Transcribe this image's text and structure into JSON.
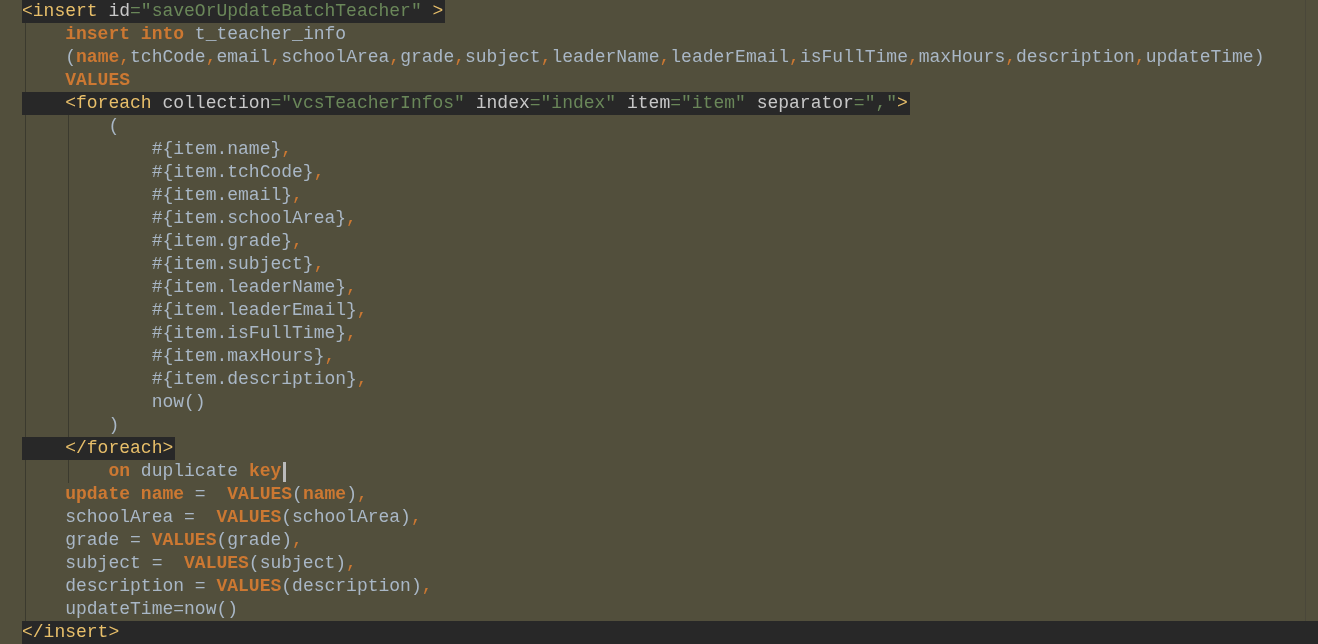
{
  "editor": {
    "lines": [
      {
        "kind": "tag",
        "tokens": [
          {
            "kind": "tag",
            "text": "<insert "
          },
          {
            "kind": "attr",
            "text": "id"
          },
          {
            "kind": "str",
            "text": "=\"saveOrUpdateBatchTeacher\""
          },
          {
            "kind": "tag",
            "text": " >"
          }
        ]
      },
      {
        "kind": "plain",
        "tokens": [
          {
            "kind": "kw",
            "text": "    insert into"
          },
          {
            "kind": "text",
            "text": " t_teacher_info"
          }
        ]
      },
      {
        "kind": "plain",
        "tokens": [
          {
            "kind": "text",
            "text": "    ("
          },
          {
            "kind": "kw",
            "text": "name"
          },
          {
            "kind": "comma",
            "text": ","
          },
          {
            "kind": "text",
            "text": "tchCode"
          },
          {
            "kind": "comma",
            "text": ","
          },
          {
            "kind": "text",
            "text": "email"
          },
          {
            "kind": "comma",
            "text": ","
          },
          {
            "kind": "text",
            "text": "schoolArea"
          },
          {
            "kind": "comma",
            "text": ","
          },
          {
            "kind": "text",
            "text": "grade"
          },
          {
            "kind": "comma",
            "text": ","
          },
          {
            "kind": "text",
            "text": "subject"
          },
          {
            "kind": "comma",
            "text": ","
          },
          {
            "kind": "text",
            "text": "leaderName"
          },
          {
            "kind": "comma",
            "text": ","
          },
          {
            "kind": "text",
            "text": "leaderEmail"
          },
          {
            "kind": "comma",
            "text": ","
          },
          {
            "kind": "text",
            "text": "isFullTime"
          },
          {
            "kind": "comma",
            "text": ","
          },
          {
            "kind": "text",
            "text": "maxHours"
          },
          {
            "kind": "comma",
            "text": ","
          },
          {
            "kind": "text",
            "text": "description"
          },
          {
            "kind": "comma",
            "text": ","
          },
          {
            "kind": "text",
            "text": "updateTime)"
          }
        ]
      },
      {
        "kind": "plain",
        "tokens": [
          {
            "kind": "kw",
            "text": "    VALUES"
          }
        ]
      },
      {
        "kind": "tag",
        "tokens": [
          {
            "kind": "tag",
            "text": "    <foreach "
          },
          {
            "kind": "attr",
            "text": "collection"
          },
          {
            "kind": "str",
            "text": "=\"vcsTeacherInfos\""
          },
          {
            "kind": "attr",
            "text": " index"
          },
          {
            "kind": "str",
            "text": "=\"index\""
          },
          {
            "kind": "attr",
            "text": " item"
          },
          {
            "kind": "str",
            "text": "=\"item\""
          },
          {
            "kind": "attr",
            "text": " separator"
          },
          {
            "kind": "str",
            "text": "=\",\""
          },
          {
            "kind": "tag",
            "text": ">"
          }
        ]
      },
      {
        "kind": "plain",
        "tokens": [
          {
            "kind": "text",
            "text": "        ("
          }
        ]
      },
      {
        "kind": "plain",
        "tokens": [
          {
            "kind": "text",
            "text": "            #{item.name}"
          },
          {
            "kind": "comma",
            "text": ","
          }
        ]
      },
      {
        "kind": "plain",
        "tokens": [
          {
            "kind": "text",
            "text": "            #{item.tchCode}"
          },
          {
            "kind": "comma",
            "text": ","
          }
        ]
      },
      {
        "kind": "plain",
        "tokens": [
          {
            "kind": "text",
            "text": "            #{item.email}"
          },
          {
            "kind": "comma",
            "text": ","
          }
        ]
      },
      {
        "kind": "plain",
        "tokens": [
          {
            "kind": "text",
            "text": "            #{item.schoolArea}"
          },
          {
            "kind": "comma",
            "text": ","
          }
        ]
      },
      {
        "kind": "plain",
        "tokens": [
          {
            "kind": "text",
            "text": "            #{item.grade}"
          },
          {
            "kind": "comma",
            "text": ","
          }
        ]
      },
      {
        "kind": "plain",
        "tokens": [
          {
            "kind": "text",
            "text": "            #{item.subject}"
          },
          {
            "kind": "comma",
            "text": ","
          }
        ]
      },
      {
        "kind": "plain",
        "tokens": [
          {
            "kind": "text",
            "text": "            #{item.leaderName}"
          },
          {
            "kind": "comma",
            "text": ","
          }
        ]
      },
      {
        "kind": "plain",
        "tokens": [
          {
            "kind": "text",
            "text": "            #{item.leaderEmail}"
          },
          {
            "kind": "comma",
            "text": ","
          }
        ]
      },
      {
        "kind": "plain",
        "tokens": [
          {
            "kind": "text",
            "text": "            #{item.isFullTime}"
          },
          {
            "kind": "comma",
            "text": ","
          }
        ]
      },
      {
        "kind": "plain",
        "tokens": [
          {
            "kind": "text",
            "text": "            #{item.maxHours}"
          },
          {
            "kind": "comma",
            "text": ","
          }
        ]
      },
      {
        "kind": "plain",
        "tokens": [
          {
            "kind": "text",
            "text": "            #{item.description}"
          },
          {
            "kind": "comma",
            "text": ","
          }
        ]
      },
      {
        "kind": "plain",
        "tokens": [
          {
            "kind": "text",
            "text": "            now()"
          }
        ]
      },
      {
        "kind": "plain",
        "tokens": [
          {
            "kind": "text",
            "text": "        )"
          }
        ]
      },
      {
        "kind": "tag",
        "tokens": [
          {
            "kind": "tag",
            "text": "    </foreach>"
          }
        ]
      },
      {
        "kind": "plain",
        "cursor": true,
        "tokens": [
          {
            "kind": "kw",
            "text": "        on"
          },
          {
            "kind": "text",
            "text": " duplicate "
          },
          {
            "kind": "kw",
            "text": "key"
          }
        ]
      },
      {
        "kind": "plain",
        "tokens": [
          {
            "kind": "kw",
            "text": "    update name"
          },
          {
            "kind": "text",
            "text": " =  "
          },
          {
            "kind": "kw",
            "text": "VALUES"
          },
          {
            "kind": "text",
            "text": "("
          },
          {
            "kind": "kw",
            "text": "name"
          },
          {
            "kind": "text",
            "text": ")"
          },
          {
            "kind": "comma",
            "text": ","
          }
        ]
      },
      {
        "kind": "plain",
        "tokens": [
          {
            "kind": "text",
            "text": "    schoolArea =  "
          },
          {
            "kind": "kw",
            "text": "VALUES"
          },
          {
            "kind": "text",
            "text": "(schoolArea)"
          },
          {
            "kind": "comma",
            "text": ","
          }
        ]
      },
      {
        "kind": "plain",
        "tokens": [
          {
            "kind": "text",
            "text": "    grade = "
          },
          {
            "kind": "kw",
            "text": "VALUES"
          },
          {
            "kind": "text",
            "text": "(grade)"
          },
          {
            "kind": "comma",
            "text": ","
          }
        ]
      },
      {
        "kind": "plain",
        "tokens": [
          {
            "kind": "text",
            "text": "    subject =  "
          },
          {
            "kind": "kw",
            "text": "VALUES"
          },
          {
            "kind": "text",
            "text": "(subject)"
          },
          {
            "kind": "comma",
            "text": ","
          }
        ]
      },
      {
        "kind": "plain",
        "tokens": [
          {
            "kind": "text",
            "text": "    description = "
          },
          {
            "kind": "kw",
            "text": "VALUES"
          },
          {
            "kind": "text",
            "text": "(description)"
          },
          {
            "kind": "comma",
            "text": ","
          }
        ]
      },
      {
        "kind": "plain",
        "tokens": [
          {
            "kind": "text",
            "text": "    updateTime=now()"
          }
        ]
      },
      {
        "kind": "end",
        "tokens": [
          {
            "kind": "tag",
            "text": "</insert>"
          }
        ]
      }
    ]
  }
}
